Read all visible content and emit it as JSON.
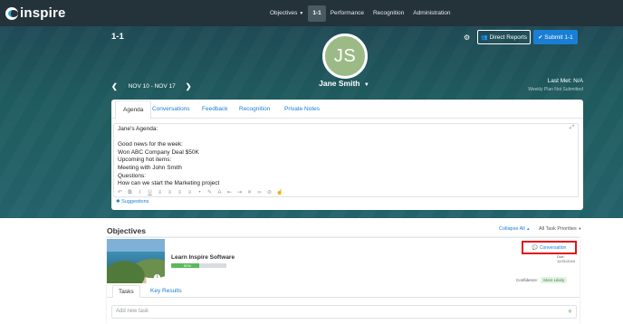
{
  "app": {
    "logo_text": "inspire"
  },
  "nav": {
    "items": [
      {
        "label": "Objectives",
        "has_caret": true,
        "active": false
      },
      {
        "label": "1-1",
        "has_caret": false,
        "active": true
      },
      {
        "label": "Performance",
        "has_caret": false,
        "active": false
      },
      {
        "label": "Recognition",
        "has_caret": false,
        "active": false
      },
      {
        "label": "Administration",
        "has_caret": false,
        "active": false
      }
    ]
  },
  "header": {
    "page_title": "1-1",
    "avatar_initials": "JS",
    "user_name": "Jane Smith",
    "direct_reports_label": "Direct Reports",
    "submit_label": "Submit 1-1",
    "week_range": "NOV 10 - NOV 17",
    "last_met": "Last Met: N/A",
    "weekly_plan_status": "Weekly Plan Not Submitted"
  },
  "editor": {
    "tabs": [
      "Agenda",
      "Conversations",
      "Feedback",
      "Recognition",
      "Private Notes"
    ],
    "active_tab": "Agenda",
    "lines": [
      "Jane's Agenda:",
      "",
      "Good news for the week:",
      "Won ABC Company Deal $50K",
      "Upcoming hot items:",
      "Meeting with John Smith",
      "Questions:",
      "How can we start the Marketing project"
    ],
    "suggestions_label": "Suggestions"
  },
  "objectives": {
    "header": "Objectives",
    "collapse_all_label": "Collapse All",
    "priorities_label": "All Task Priorities",
    "item": {
      "title": "Learn Inspire Software",
      "progress_percent": 50,
      "progress_label": "50%",
      "conversation_label": "Conversation",
      "due": "Due: 12/31/2024",
      "confidence_label": "Confidence:",
      "confidence_value": "More Likely",
      "tabs": [
        "Tasks",
        "Key Results"
      ],
      "add_task_placeholder": "Add new task"
    }
  },
  "colors": {
    "nav_bg": "#24323a",
    "accent_blue": "#1a7fd4",
    "avatar_green": "#9cba86",
    "highlight_red": "#e3141b",
    "progress_green": "#5cb85c"
  }
}
